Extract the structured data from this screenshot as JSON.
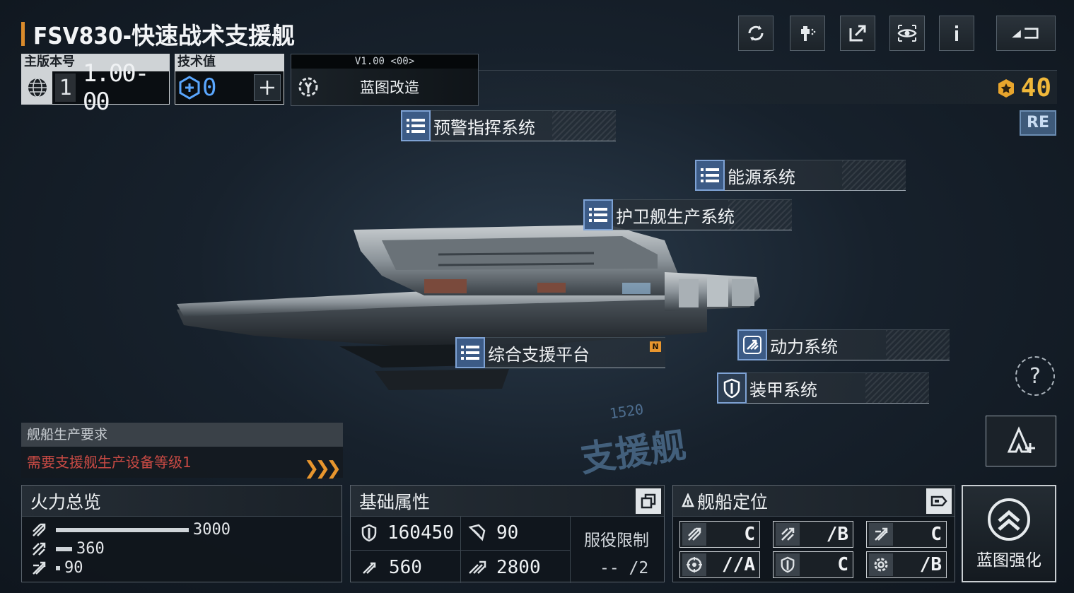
{
  "title": "FSV830-快速战术支援舰",
  "version": {
    "label": "主版本号",
    "major": "1",
    "minor": "1.00-00"
  },
  "tech": {
    "label": "技术值",
    "value": "0"
  },
  "blueprint": {
    "version": "V1.00 <00>",
    "label": "蓝图改造"
  },
  "credits": "40",
  "re_badge": "RE",
  "systems": [
    {
      "label": "预警指挥系统"
    },
    {
      "label": "能源系统"
    },
    {
      "label": "护卫舰生产系统"
    },
    {
      "label": "综合支援平台",
      "badge": "N"
    },
    {
      "label": "动力系统"
    },
    {
      "label": "装甲系统"
    }
  ],
  "hull": {
    "class_text": "支援舰",
    "number": "1520"
  },
  "production": {
    "title": "舰船生产要求",
    "requirement": "需要支援舰生产设备等级1"
  },
  "firepower": {
    "title": "火力总览",
    "rows": [
      {
        "value": "3000",
        "ratio": 1.0
      },
      {
        "value": "360",
        "ratio": 0.12
      },
      {
        "value": "90",
        "ratio": 0.03
      }
    ]
  },
  "attributes": {
    "title": "基础属性",
    "hp": "160450",
    "armor": "90",
    "speed": "560",
    "warp": "2800",
    "service_label": "服役限制",
    "service_value": "-- /2"
  },
  "roles": {
    "title": "舰船定位",
    "cells": [
      {
        "icon": "missile-icon",
        "grade": "C"
      },
      {
        "icon": "projectile-icon",
        "grade": "/B"
      },
      {
        "icon": "aircraft-icon",
        "grade": "C"
      },
      {
        "icon": "crosshair-icon",
        "grade": "//A"
      },
      {
        "icon": "shield-icon",
        "grade": "C"
      },
      {
        "icon": "gear-icon",
        "grade": "/B"
      }
    ]
  },
  "enhance": {
    "label": "蓝图强化"
  },
  "help": "?"
}
